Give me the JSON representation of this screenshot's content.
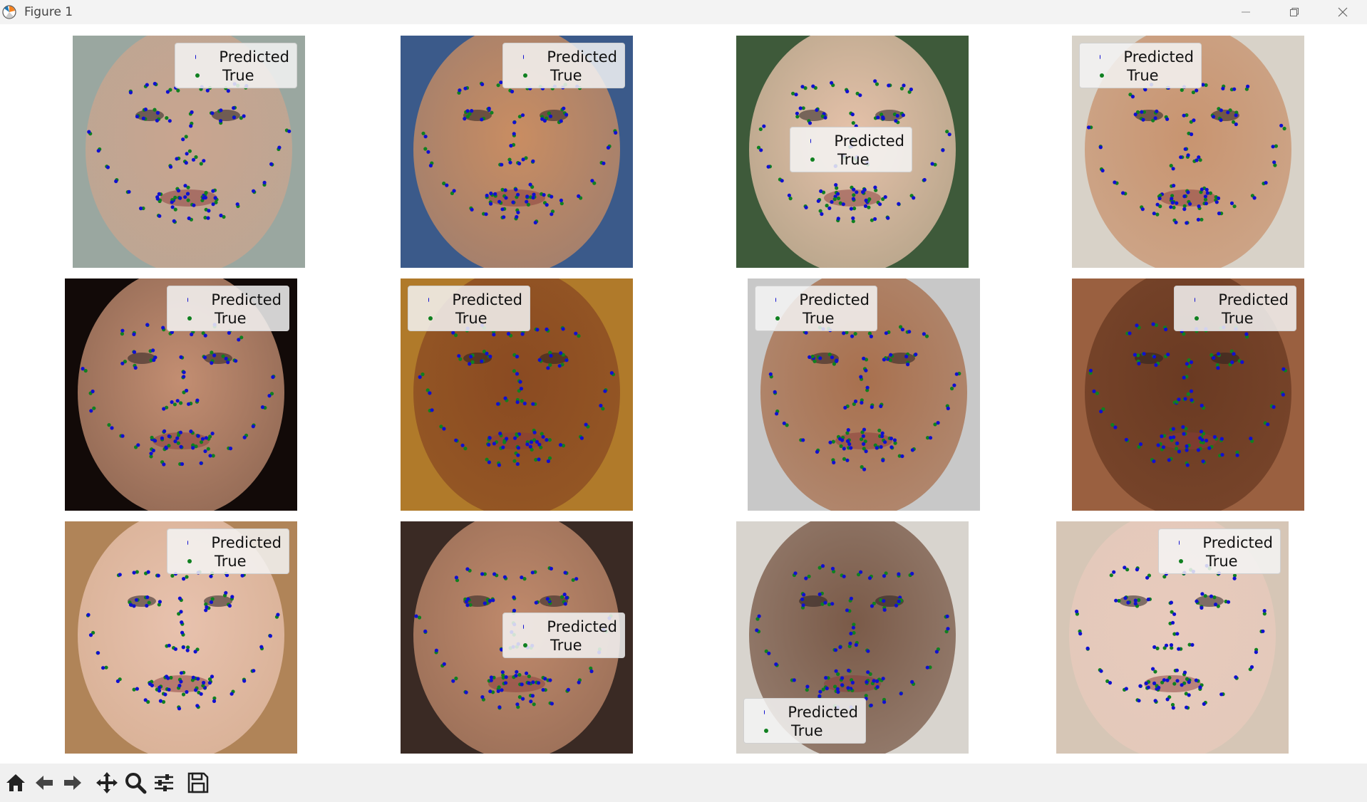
{
  "window": {
    "title": "Figure 1",
    "icon": "matplotlib-icon",
    "controls": [
      "minimize-icon",
      "restore-icon",
      "close-icon"
    ]
  },
  "legend": {
    "predicted_label": "Predicted",
    "true_label": "True",
    "predicted_color": "#1010d0",
    "true_color": "#108020"
  },
  "subplots": [
    {
      "id": 1,
      "skin": "#c9a58f",
      "bg": "#9aa7a0",
      "legend": "top-right"
    },
    {
      "id": 2,
      "skin": "#c98d62",
      "bg": "#3b5a8a",
      "legend": "top-right"
    },
    {
      "id": 3,
      "skin": "#e6c2aa",
      "bg": "#3e5a3a",
      "legend": "center"
    },
    {
      "id": 4,
      "skin": "#c89470",
      "bg": "#d8d2c8",
      "legend": "top-left"
    },
    {
      "id": 5,
      "skin": "#c38e72",
      "bg": "#120a08",
      "legend": "top-right"
    },
    {
      "id": 6,
      "skin": "#8a4a22",
      "bg": "#b07a2a",
      "legend": "top-left"
    },
    {
      "id": 7,
      "skin": "#a8704e",
      "bg": "#c8c8c8",
      "legend": "top-left"
    },
    {
      "id": 8,
      "skin": "#6a3a22",
      "bg": "#9a6040",
      "legend": "top-right"
    },
    {
      "id": 9,
      "skin": "#e8c2ae",
      "bg": "#b08458",
      "legend": "top-right"
    },
    {
      "id": 10,
      "skin": "#c08a6c",
      "bg": "#3a2a24",
      "legend": "right-center"
    },
    {
      "id": 11,
      "skin": "#7a5a48",
      "bg": "#d8d4ce",
      "legend": "bottom-left"
    },
    {
      "id": 12,
      "skin": "#e8cabc",
      "bg": "#d6c6b6",
      "legend": "top-right"
    }
  ],
  "toolbar": {
    "tools": [
      "home-icon",
      "back-icon",
      "forward-icon",
      "pan-icon",
      "zoom-icon",
      "configure-subplots-icon",
      "save-icon"
    ]
  }
}
